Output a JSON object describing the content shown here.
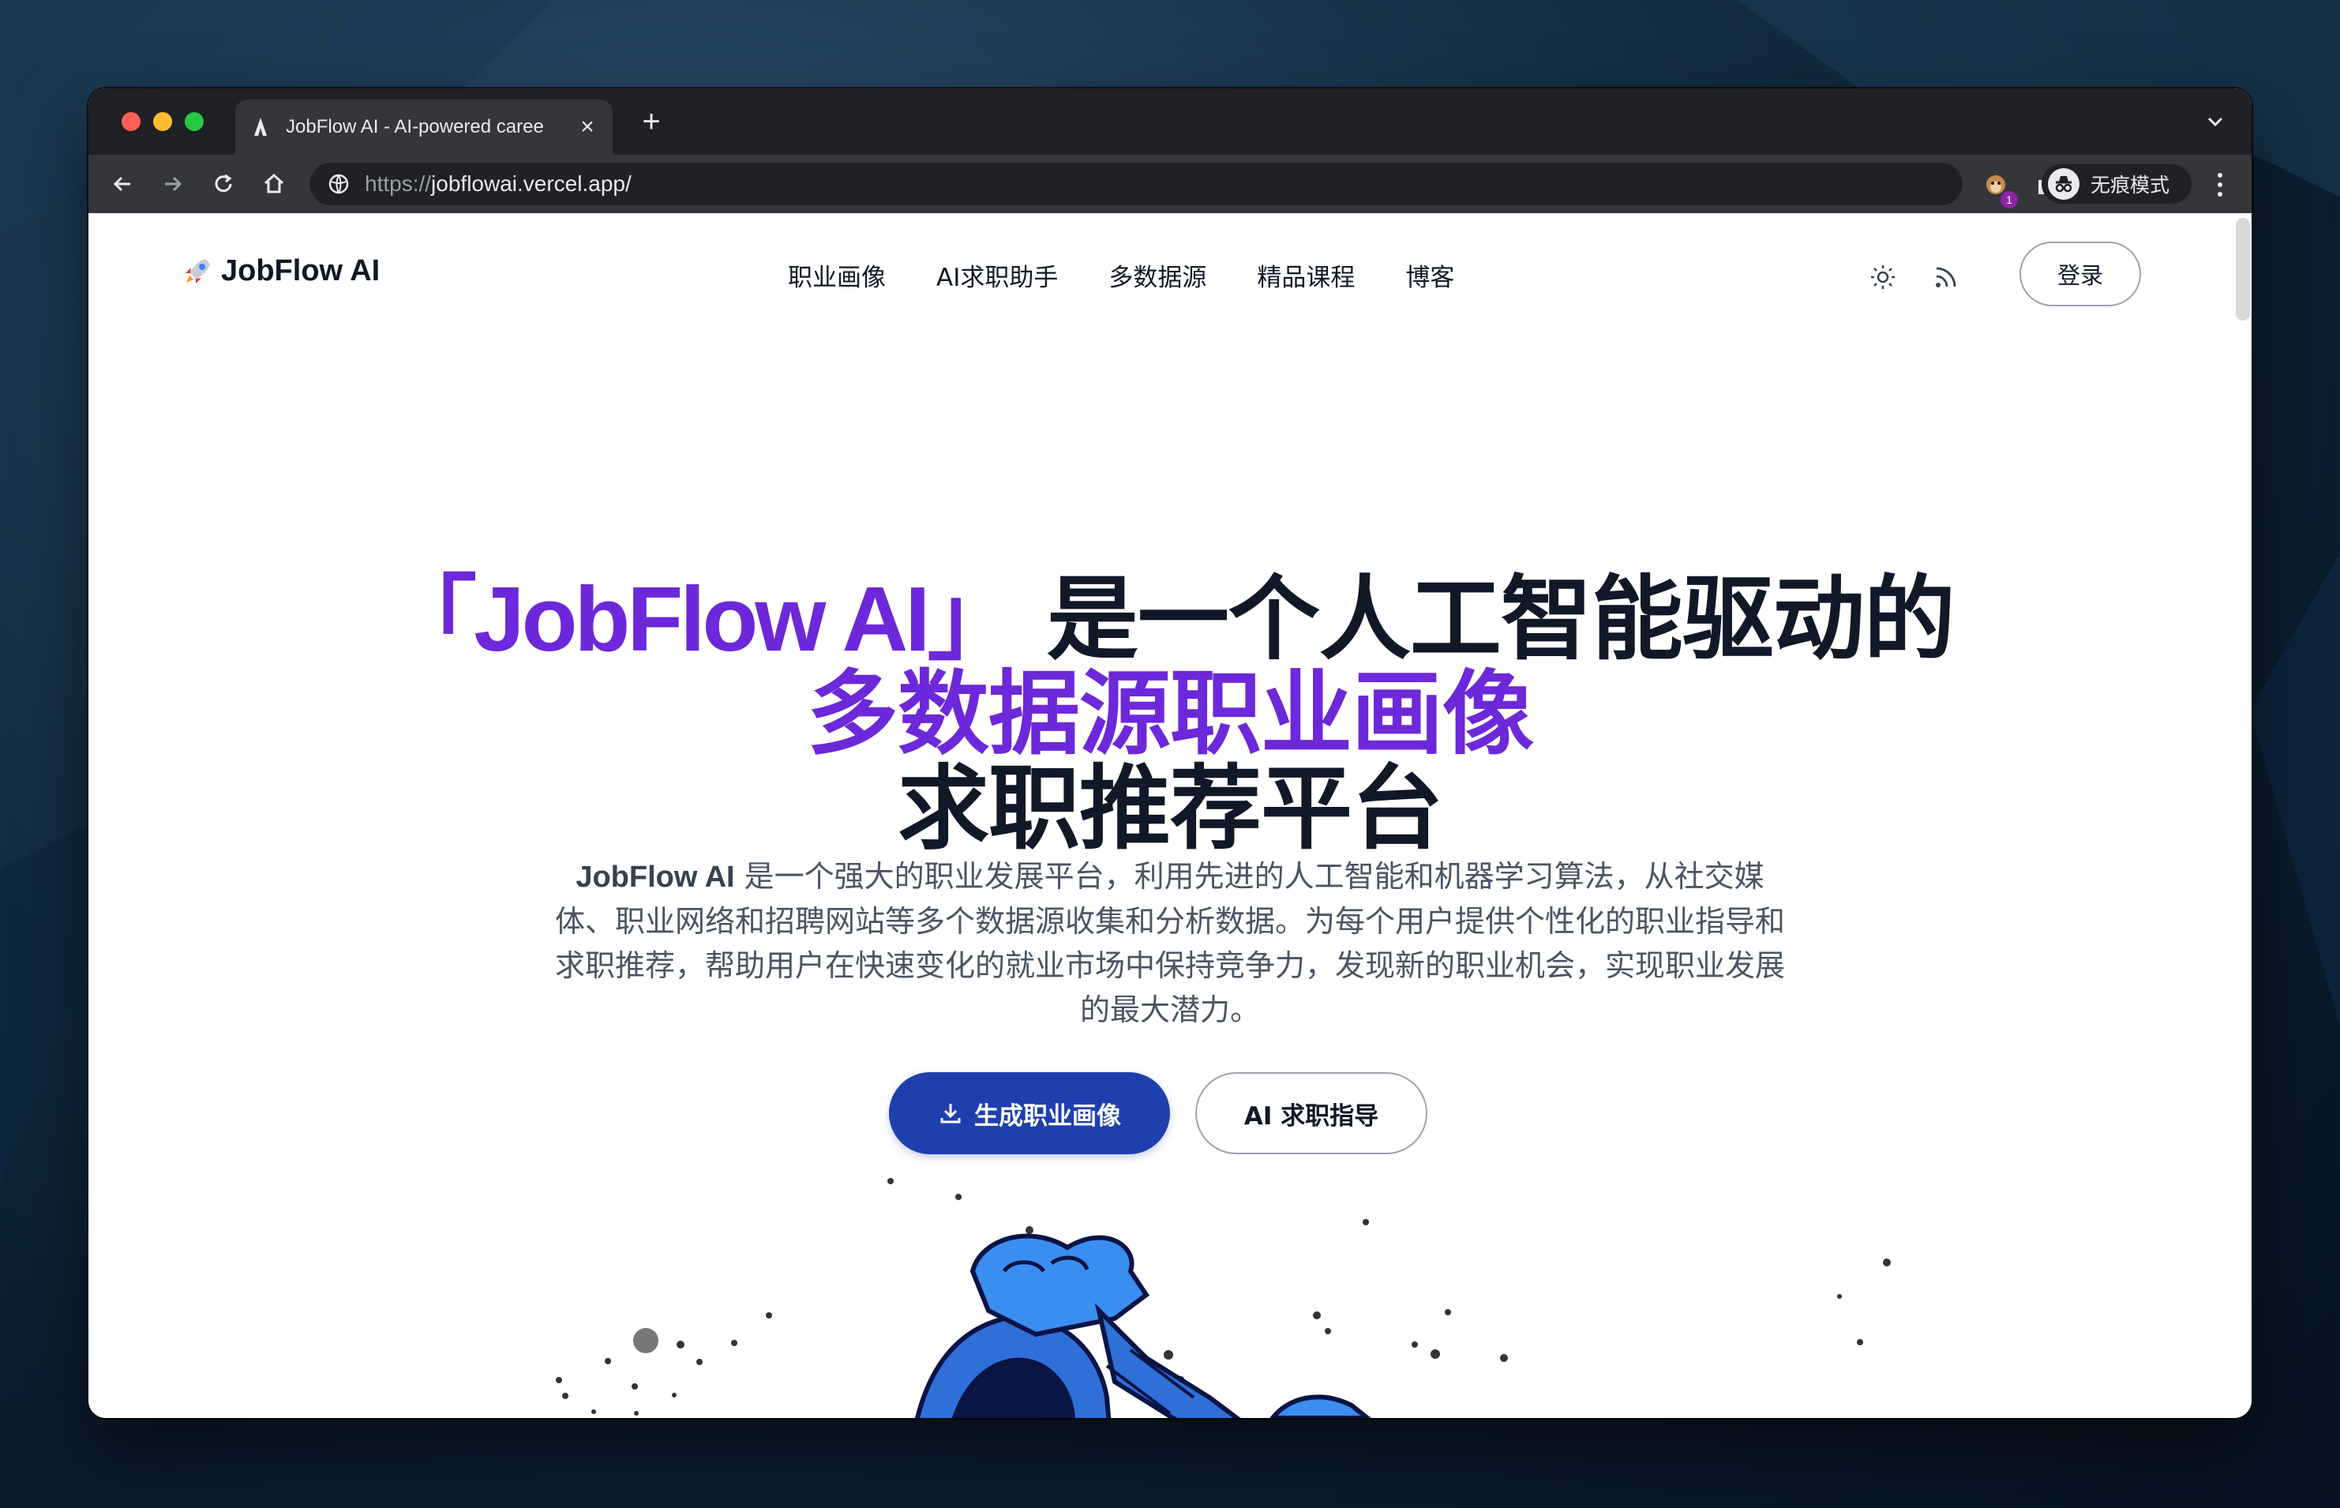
{
  "browser": {
    "tab_title": "JobFlow AI - AI-powered caree",
    "new_tab_label": "+",
    "url_scheme": "https://",
    "url_host": "jobflowai.vercel.app/",
    "extension_badge": "1",
    "incognito_label": "无痕模式"
  },
  "site": {
    "logo_text": "JobFlow AI",
    "nav": [
      "职业画像",
      "AI求职助手",
      "多数据源",
      "精品课程",
      "博客"
    ],
    "login_label": "登录"
  },
  "hero": {
    "title_brand": "「JobFlow AI」",
    "title_line1_rest": " 是一个人工智能驱动的",
    "title_line2": "多数据源职业画像",
    "title_line3": "求职推荐平台",
    "desc_brand": "JobFlow AI",
    "desc_text": " 是一个强大的职业发展平台，利用先进的人工智能和机器学习算法，从社交媒体、职业网络和招聘网站等多个数据源收集和分析数据。为每个用户提供个性化的职业指导和求职推荐，帮助用户在快速变化的就业市场中保持竞争力，发现新的职业机会，实现职业发展的最大潜力。",
    "primary_button": "生成职业画像",
    "secondary_button": "AI 求职指导"
  },
  "colors": {
    "accent_purple": "#6d28d9",
    "primary_blue": "#1e40af",
    "text_dark": "#111827"
  }
}
